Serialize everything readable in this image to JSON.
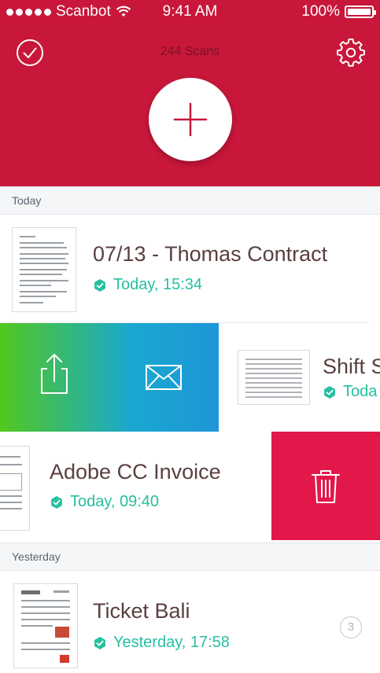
{
  "status_bar": {
    "carrier": "Scanbot",
    "time": "9:41 AM",
    "battery": "100%"
  },
  "header": {
    "scan_count": "244 Scans",
    "background_color": "#c8173a",
    "icons": {
      "left": "checkmark-circle-icon",
      "right": "gear-icon",
      "add": "plus-icon"
    }
  },
  "sections": {
    "today": "Today",
    "yesterday": "Yesterday"
  },
  "scans": [
    {
      "title": "07/13 - Thomas Contract",
      "date": "Today, 15:34"
    },
    {
      "title": "Shift S",
      "date": "Toda"
    },
    {
      "title": "Adobe CC Invoice",
      "date": "Today, 09:40"
    },
    {
      "title": "Ticket Bali",
      "date": "Yesterday, 17:58",
      "pages": "3"
    }
  ],
  "swipe_actions": {
    "share_icon": "share-icon",
    "email_icon": "mail-icon",
    "delete_icon": "trash-icon"
  },
  "colors": {
    "accent": "#c8173a",
    "success": "#26c0a0",
    "delete": "#e2174a",
    "gradient_start": "#52c81e",
    "gradient_end": "#1e96d8"
  }
}
